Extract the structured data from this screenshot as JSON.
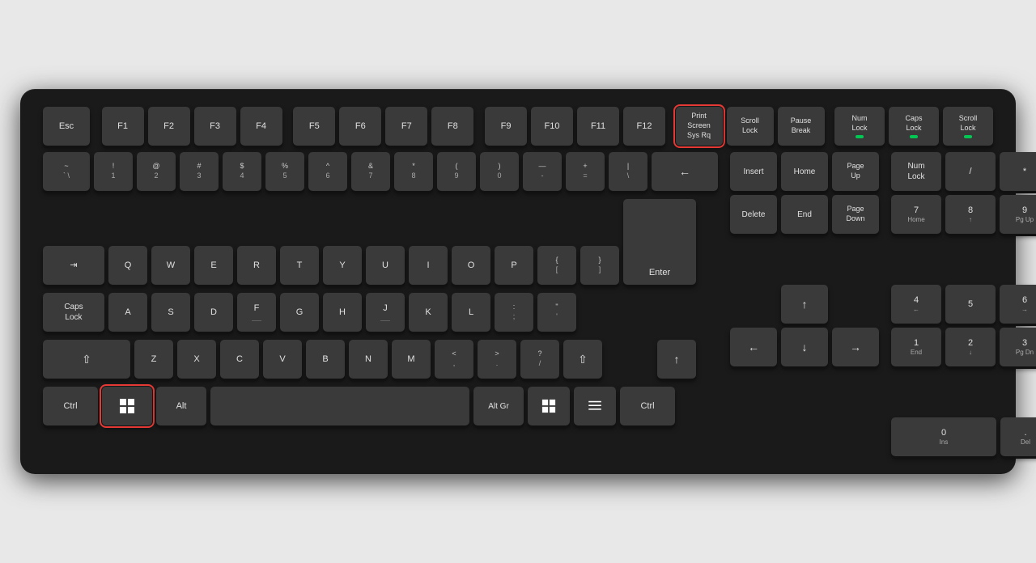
{
  "keyboard": {
    "background": "#1a1a1a",
    "rows": {
      "fn_row": {
        "keys": [
          {
            "id": "esc",
            "label": "Esc",
            "highlighted": false
          },
          {
            "id": "f1",
            "label": "F1",
            "highlighted": false
          },
          {
            "id": "f2",
            "label": "F2",
            "highlighted": false
          },
          {
            "id": "f3",
            "label": "F3",
            "highlighted": false
          },
          {
            "id": "f4",
            "label": "F4",
            "highlighted": false
          },
          {
            "id": "f5",
            "label": "F5",
            "highlighted": false
          },
          {
            "id": "f6",
            "label": "F6",
            "highlighted": false
          },
          {
            "id": "f7",
            "label": "F7",
            "highlighted": false
          },
          {
            "id": "f8",
            "label": "F8",
            "highlighted": false
          },
          {
            "id": "f9",
            "label": "F9",
            "highlighted": false
          },
          {
            "id": "f10",
            "label": "F10",
            "highlighted": false
          },
          {
            "id": "f11",
            "label": "F11",
            "highlighted": false
          },
          {
            "id": "f12",
            "label": "F12",
            "highlighted": false
          },
          {
            "id": "print_screen",
            "label": "Print Screen",
            "sublabel": "Sys Rq",
            "highlighted": true
          },
          {
            "id": "scroll_lock",
            "label": "Scroll Lock",
            "highlighted": false,
            "indicator": "off"
          },
          {
            "id": "pause",
            "label": "Pause",
            "sublabel": "Break",
            "highlighted": false
          },
          {
            "id": "num_lock",
            "label": "Num Lock",
            "highlighted": false,
            "indicator": "green"
          },
          {
            "id": "caps_lock_top",
            "label": "Caps Lock",
            "highlighted": false,
            "indicator": "green"
          },
          {
            "id": "scroll_lock2",
            "label": "Scroll Lock",
            "highlighted": false,
            "indicator": "green"
          }
        ]
      }
    }
  }
}
